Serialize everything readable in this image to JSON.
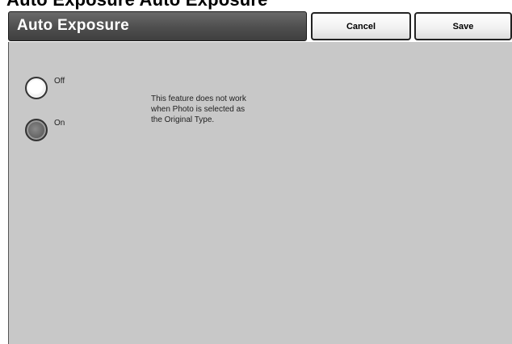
{
  "top_caption": "Auto Exposure Auto Exposure",
  "header": {
    "title": "Auto Exposure",
    "cancel_label": "Cancel",
    "save_label": "Save"
  },
  "options": {
    "off_label": "Off",
    "on_label": "On",
    "selected": "On"
  },
  "info": {
    "lines": [
      "This feature does not work",
      "when Photo is selected as",
      "the Original Type."
    ]
  }
}
